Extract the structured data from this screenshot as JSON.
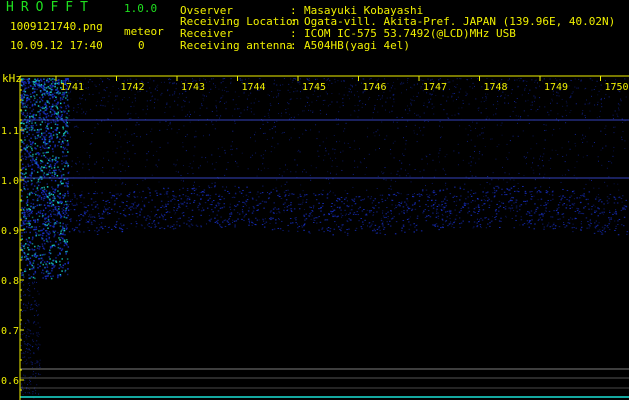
{
  "header": {
    "app_title": "HROFFT",
    "version": "1.0.0",
    "file_name": "1009121740.png",
    "timestamp": "10.09.12 17:40",
    "meteor_label": "meteor",
    "meteor_count": "0"
  },
  "info": [
    {
      "label": "Ovserver",
      "value": "Masayuki Kobayashi"
    },
    {
      "label": "Receiving Location",
      "value": "Ogata-vill. Akita-Pref. JAPAN (139.96E, 40.02N)"
    },
    {
      "label": "Receiver",
      "value": "ICOM IC-575 53.7492(@LCD)MHz USB"
    },
    {
      "label": "Receiving antenna",
      "value": "A504HB(yagi 4el)"
    }
  ],
  "spectrogram": {
    "y_unit": "kHz",
    "y_ticks": [
      "1.1",
      "1.0",
      "0.9",
      "0.8",
      "0.7",
      "0.6"
    ],
    "x_ticks": [
      "1741",
      "1742",
      "1743",
      "1744",
      "1745",
      "1746",
      "1747",
      "1748",
      "1749",
      "1750"
    ],
    "colors": {
      "background": "#000000",
      "signal": "#1830c8",
      "hot": "#19d3c8",
      "axis": "#f0f000",
      "carrier": "#3a4ad0"
    }
  }
}
